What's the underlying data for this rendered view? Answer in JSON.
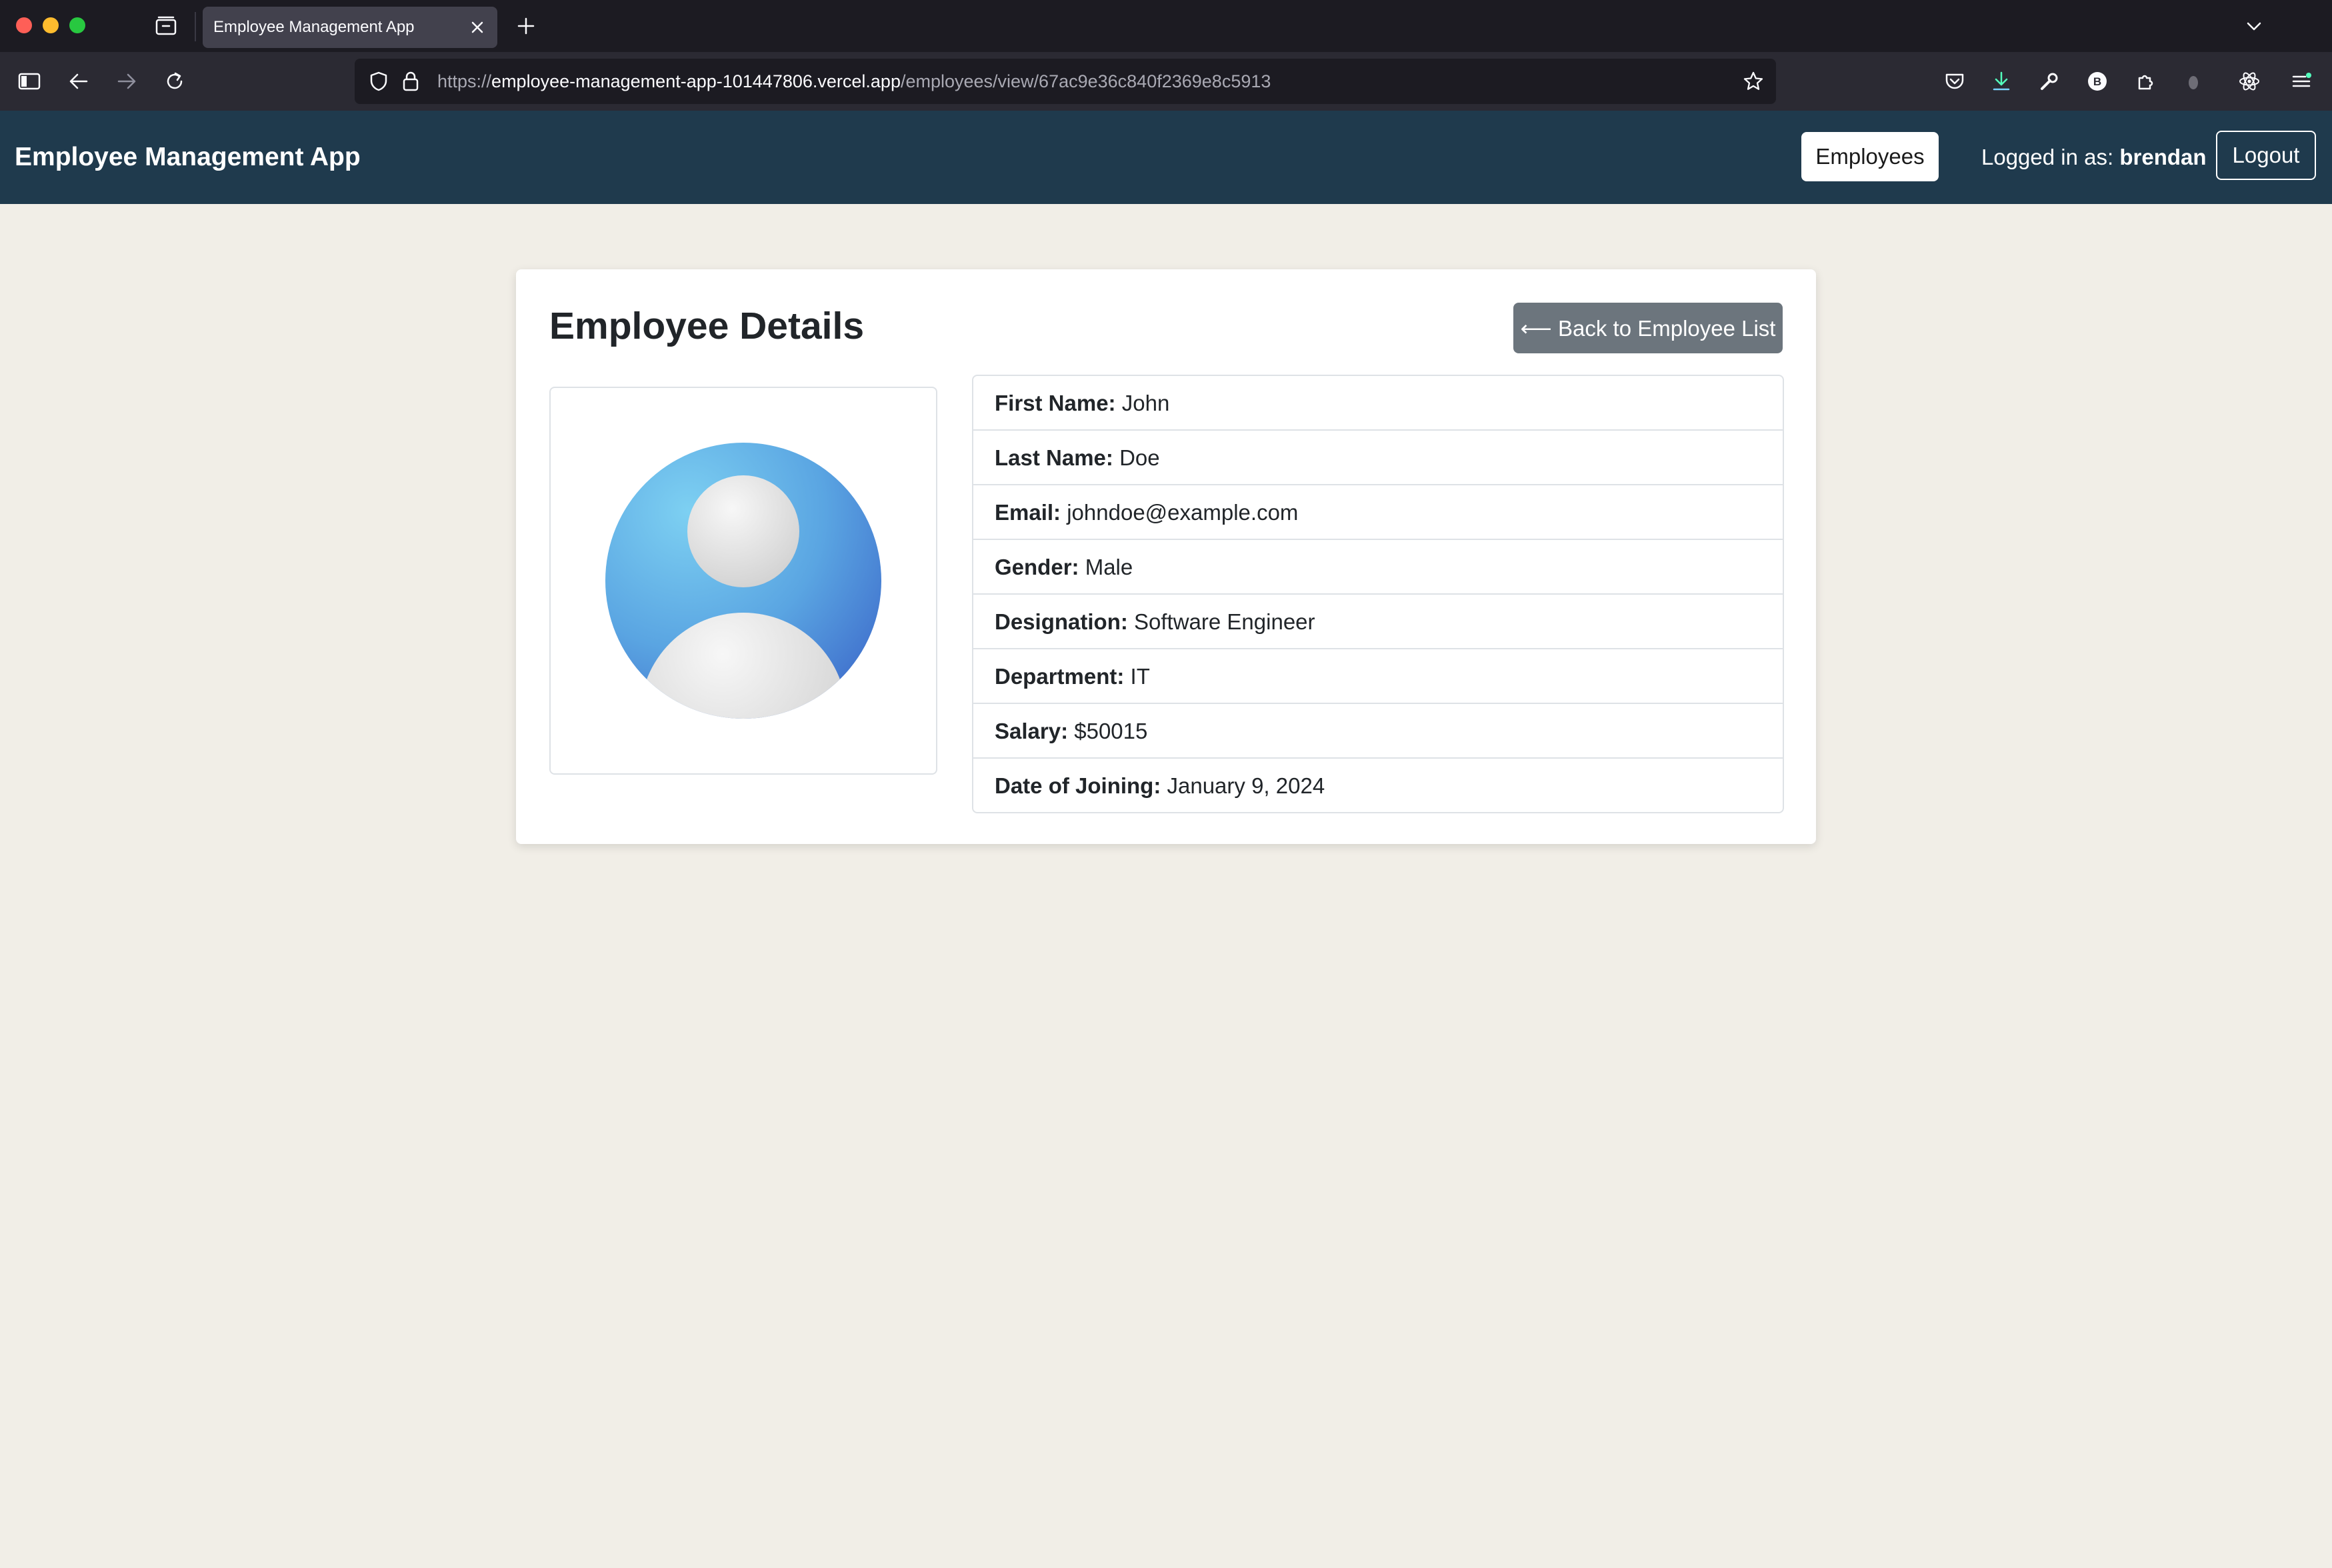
{
  "browser": {
    "tab_title": "Employee Management App",
    "url_prefix": "https://",
    "url_host": "employee-management-app-101447806.vercel.app",
    "url_path": "/employees/view/67ac9e36c840f2369e8c5913"
  },
  "app": {
    "brand": "Employee Management App",
    "nav": {
      "employees_label": "Employees",
      "logged_in_prefix": "Logged in as:",
      "username": "brendan",
      "logout_label": "Logout"
    }
  },
  "card": {
    "title": "Employee Details",
    "back_label": "⟵ Back to Employee List",
    "fields": [
      {
        "label": "First Name:",
        "value": "John"
      },
      {
        "label": "Last Name:",
        "value": "Doe"
      },
      {
        "label": "Email:",
        "value": "johndoe@example.com"
      },
      {
        "label": "Gender:",
        "value": "Male"
      },
      {
        "label": "Designation:",
        "value": "Software Engineer"
      },
      {
        "label": "Department:",
        "value": "IT"
      },
      {
        "label": "Salary:",
        "value": "$50015"
      },
      {
        "label": "Date of Joining:",
        "value": "January 9, 2024"
      }
    ]
  },
  "colors": {
    "app_nav_bg": "#1f3a4d",
    "page_bg": "#f1eee7",
    "back_button_bg": "#6c757d"
  }
}
